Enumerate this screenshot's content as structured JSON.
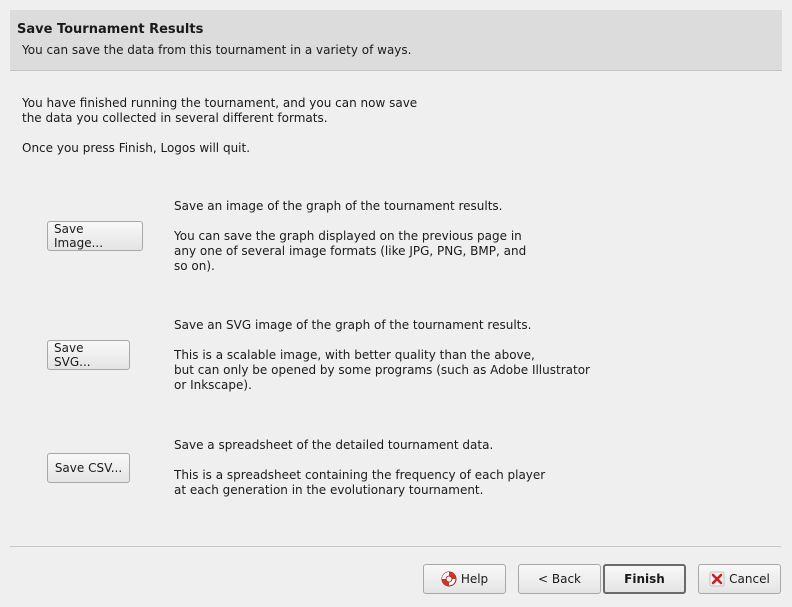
{
  "header": {
    "title": "Save Tournament Results",
    "subtitle": "You can save the data from this tournament in a variety of ways."
  },
  "intro": {
    "paragraph1": "You have finished running the tournament, and you can now save\nthe data you collected in several different formats.",
    "paragraph2": "Once you press Finish, Logos will quit."
  },
  "options": [
    {
      "button_label": "Save Image...",
      "summary": "Save an image of the graph of the tournament results.",
      "detail": "You can save the graph displayed on the previous page in\nany one of several image formats (like JPG, PNG, BMP, and\nso on)."
    },
    {
      "button_label": "Save SVG...",
      "summary": "Save an SVG image of the graph of the tournament results.",
      "detail": "This is a scalable image, with better quality than the above,\nbut can only be opened by some programs (such as Adobe Illustrator\nor Inkscape)."
    },
    {
      "button_label": "Save CSV...",
      "summary": "Save a spreadsheet of the detailed tournament data.",
      "detail": "This is a spreadsheet containing the frequency of each player\nat each generation in the evolutionary tournament."
    }
  ],
  "footer": {
    "help_label": "Help",
    "back_label": "< Back",
    "finish_label": "Finish",
    "cancel_label": "Cancel"
  },
  "icons": {
    "help": "lifebuoy-icon",
    "cancel": "red-x-icon"
  },
  "colors": {
    "help_icon": "#d9302c",
    "cancel_icon": "#cc1f1f"
  }
}
